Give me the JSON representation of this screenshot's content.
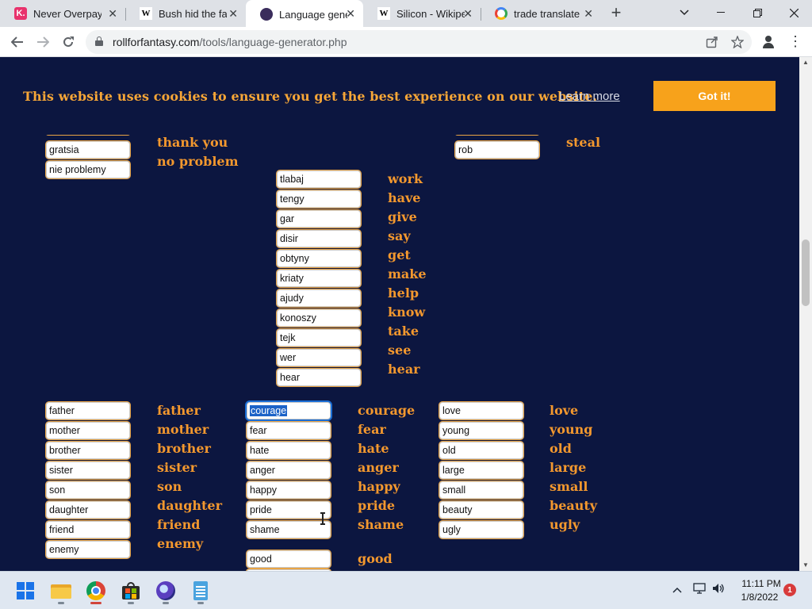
{
  "browser": {
    "tabs": [
      {
        "title": "Never Overpay f",
        "favicon": "klarna-icon"
      },
      {
        "title": "Bush hid the fac",
        "favicon": "wikipedia-icon"
      },
      {
        "title": "Language gener",
        "favicon": "rollforfantasy-icon"
      },
      {
        "title": "Silicon - Wikipe",
        "favicon": "wikipedia-icon"
      },
      {
        "title": "trade translate t",
        "favicon": "google-icon"
      }
    ],
    "active_tab_index": 2,
    "tab_close_glyph": "✕",
    "new_tab_glyph": "+",
    "url_host": "rollforfantasy.com",
    "url_path": "/tools/language-generator.php"
  },
  "cookie_banner": {
    "message": "This website uses cookies to ensure you get the best experience on our website.",
    "learn_more": "Learn more",
    "accept": "Got it!"
  },
  "groups": {
    "top_left": {
      "inputs": [
        "gratsia",
        "nie problemy"
      ],
      "english": [
        "thank you",
        "no problem"
      ]
    },
    "top_right": {
      "inputs": [
        "rob"
      ],
      "english": [
        "steal"
      ]
    },
    "verbs": {
      "inputs": [
        "tlabaj",
        "tengy",
        "gar",
        "disir",
        "obtyny",
        "kriaty",
        "ajudy",
        "konoszy",
        "tejk",
        "wer",
        "hear"
      ],
      "english": [
        "work",
        "have",
        "give",
        "say",
        "get",
        "make",
        "help",
        "know",
        "take",
        "see",
        "hear"
      ]
    },
    "family": {
      "inputs": [
        "father",
        "mother",
        "brother",
        "sister",
        "son",
        "daughter",
        "friend",
        "enemy"
      ],
      "english": [
        "father",
        "mother",
        "brother",
        "sister",
        "son",
        "daughter",
        "friend",
        "enemy"
      ]
    },
    "emotions": {
      "inputs": [
        "courage",
        "fear",
        "hate",
        "anger",
        "happy",
        "pride",
        "shame"
      ],
      "english": [
        "courage",
        "fear",
        "hate",
        "anger",
        "happy",
        "pride",
        "shame"
      ],
      "extra_input": "good",
      "extra_english": "good"
    },
    "adjectives": {
      "inputs": [
        "love",
        "young",
        "old",
        "large",
        "small",
        "beauty",
        "ugly"
      ],
      "english": [
        "love",
        "young",
        "old",
        "large",
        "small",
        "beauty",
        "ugly"
      ]
    }
  },
  "taskbar": {
    "clock_time": "11:11 PM",
    "clock_date": "1/8/2022",
    "notification_count": "1"
  }
}
